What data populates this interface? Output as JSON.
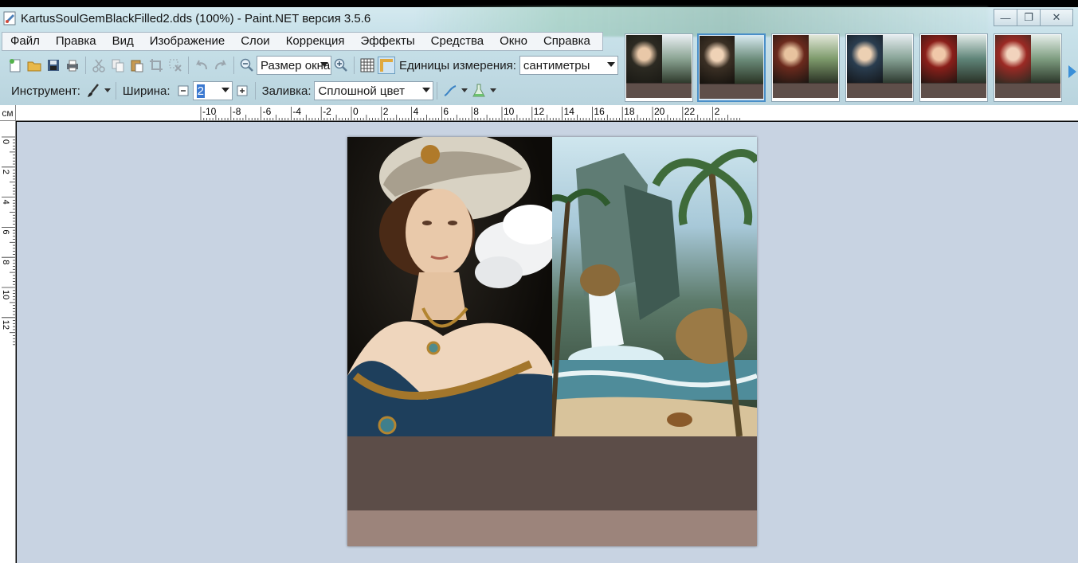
{
  "window": {
    "title": "KartusSoulGemBlackFilled2.dds (100%) - Paint.NET версия 3.5.6",
    "buttons": [
      "—",
      "❐",
      "✕"
    ]
  },
  "menu": [
    "Файл",
    "Правка",
    "Вид",
    "Изображение",
    "Слои",
    "Коррекция",
    "Эффекты",
    "Средства",
    "Окно",
    "Справка"
  ],
  "toolbar": {
    "zoom_value": "Размер окна",
    "units_label": "Единицы измерения:",
    "units_value": "сантиметры",
    "tool_label": "Инструмент:",
    "width_label": "Ширина:",
    "width_value": "2",
    "fill_label": "Заливка:",
    "fill_value": "Сплошной цвет"
  },
  "ruler": {
    "unit": "см",
    "h_ticks": [
      "-10",
      "-8",
      "-6",
      "-4",
      "-2",
      "0",
      "2",
      "4",
      "6",
      "8",
      "10",
      "12",
      "14",
      "16",
      "18",
      "20",
      "22",
      "2"
    ],
    "v_ticks": [
      "0",
      "2",
      "4",
      "6",
      "8",
      "10",
      "12"
    ]
  },
  "colors": {
    "workspace": "#c8d3e2",
    "band_dark": "#5c4d48",
    "band_light": "#9c847b",
    "accent": "#4a8fc8"
  },
  "thumbnails": [
    {
      "name": "image-1",
      "active": false
    },
    {
      "name": "image-2",
      "active": true
    },
    {
      "name": "image-3",
      "active": false
    },
    {
      "name": "image-4",
      "active": false
    },
    {
      "name": "image-5",
      "active": false
    },
    {
      "name": "image-6",
      "active": false
    }
  ]
}
